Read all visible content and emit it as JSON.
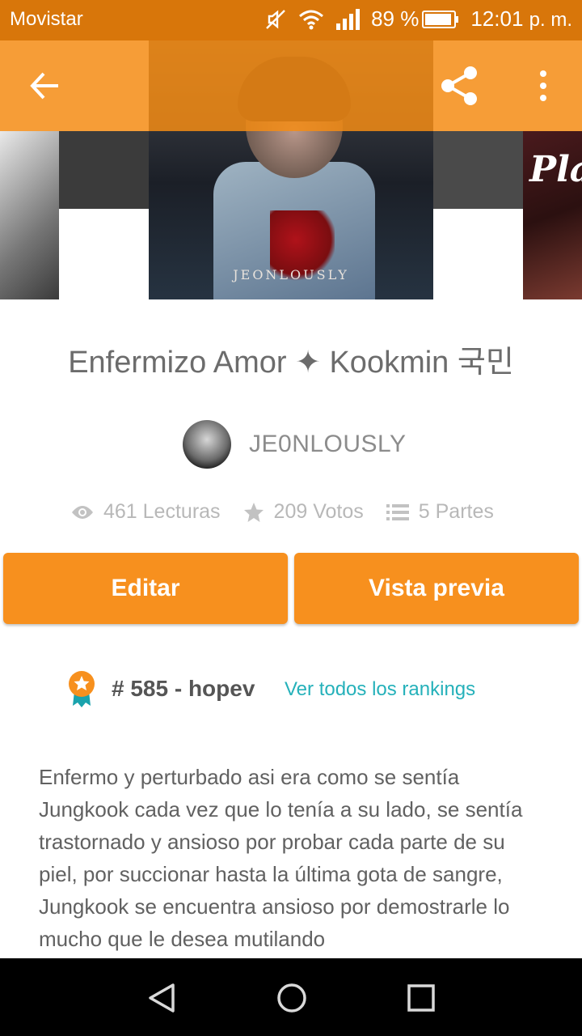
{
  "status_bar": {
    "carrier": "Movistar",
    "battery": "89 %",
    "time": "12:01",
    "time_suffix": "p. m.",
    "icons": [
      "mute-icon",
      "wifi-icon",
      "signal-icon",
      "battery-icon"
    ]
  },
  "toolbar": {
    "icons": [
      "back-arrow-icon",
      "share-icon",
      "more-vert-icon"
    ]
  },
  "cover": {
    "main_watermark": "JEONLOUSLY",
    "right_card_text": "Pla"
  },
  "story": {
    "title": "Enfermizo Amor ✦ Kookmin 국민",
    "author": "JE0NLOUSLY",
    "stats": {
      "reads": "461 Lecturas",
      "votes": "209 Votos",
      "parts": "5 Partes"
    }
  },
  "actions": {
    "edit_label": "Editar",
    "preview_label": "Vista previa"
  },
  "ranking": {
    "text": "# 585 - hopev",
    "link": "Ver todos los rankings"
  },
  "description": "Enfermo y perturbado asi era como se sentía Jungkook cada vez que lo tenía a su lado, se sentía trastornado y ansioso por probar cada parte de su piel, por succionar hasta la última gota de sangre, Jungkook se encuentra ansioso por demostrarle lo mucho que le desea mutilando",
  "colors": {
    "accent": "#f7901e",
    "status_bar": "#d8760a",
    "link": "#25b1ba"
  }
}
